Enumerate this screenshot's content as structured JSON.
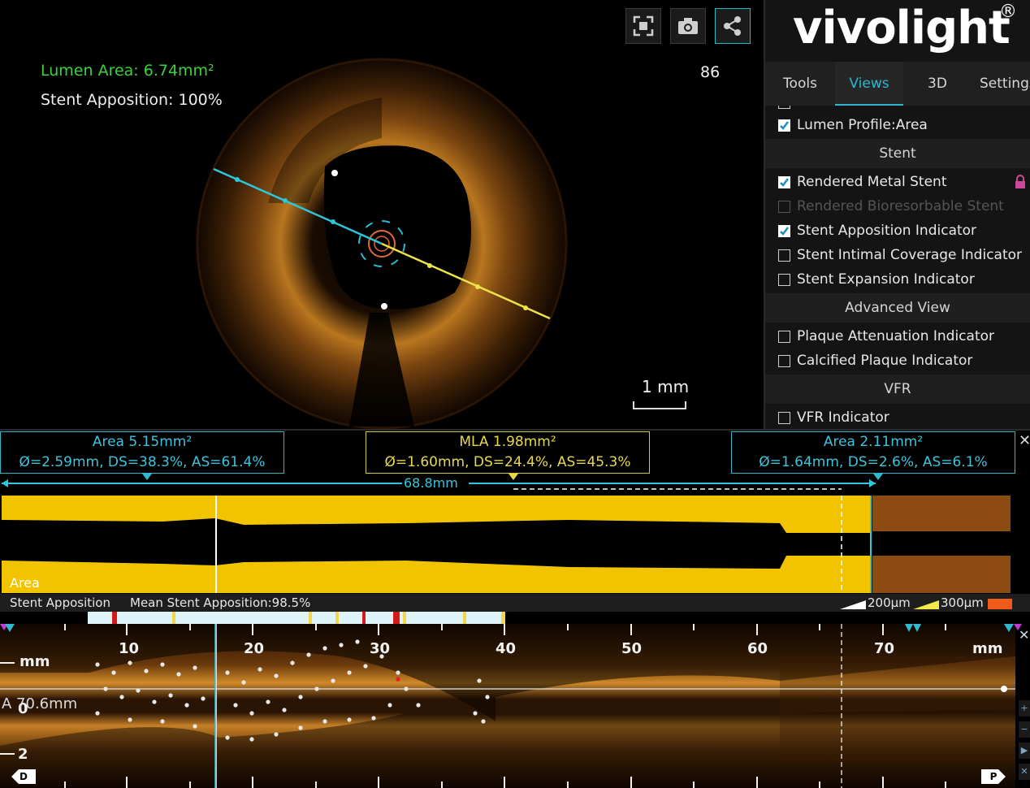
{
  "viewer": {
    "lumen_area": "Lumen Area: 6.74mm²",
    "stent_apposition": "Stent Apposition: 100%",
    "frame_number": "86",
    "scale_label": "1 mm",
    "toolbar": {
      "fullscreen_icon": "fullscreen-icon",
      "camera_icon": "camera-icon",
      "share_icon": "share-icon"
    }
  },
  "panel": {
    "brand": "vivolight",
    "brand_mark": "®",
    "tabs": [
      "Tools",
      "Views",
      "3D",
      "Settings"
    ],
    "active_tab": "Views",
    "items": {
      "lumen_profile": "Lumen Profile:Area",
      "section_stent": "Stent",
      "rendered_metal": "Rendered Metal Stent",
      "rendered_bioresorbable": "Rendered Bioresorbable Stent",
      "stent_apposition": "Stent Apposition Indicator",
      "stent_intimal": "Stent Intimal Coverage Indicator",
      "stent_expansion": "Stent Expansion Indicator",
      "section_advanced": "Advanced View",
      "plaque_attenuation": "Plaque Attenuation Indicator",
      "calcified_plaque": "Calcified Plaque Indicator",
      "section_vfr": "VFR",
      "vfr_indicator": "VFR Indicator"
    },
    "checked": {
      "lumen_profile": true,
      "rendered_metal": true,
      "rendered_bioresorbable": false,
      "stent_apposition": true,
      "stent_intimal": false,
      "stent_expansion": false,
      "plaque_attenuation": false,
      "calcified_plaque": false,
      "vfr_indicator": false
    }
  },
  "measurements": {
    "left": {
      "title": "Area 5.15mm²",
      "detail": "Ø=2.59mm, DS=38.3%, AS=61.4%"
    },
    "middle": {
      "title": "MLA 1.98mm²",
      "detail": "Ø=1.60mm, DS=24.4%, AS=45.3%"
    },
    "right": {
      "title": "Area 2.11mm²",
      "detail": "Ø=1.64mm, DS=2.6%, AS=6.1%"
    },
    "length": "68.8mm"
  },
  "profile": {
    "label": "Area"
  },
  "apposition_strip": {
    "title": "Stent Apposition",
    "mean": "Mean Stent Apposition:98.5%",
    "legend_200": "200µm",
    "legend_300": "300µm"
  },
  "long_view": {
    "ticks": [
      "10",
      "20",
      "30",
      "40",
      "50",
      "60",
      "70"
    ],
    "unit_left": "mm",
    "unit_right": "mm",
    "depth_0": "0",
    "depth_2": "2",
    "cursor_label": "A 70.6mm",
    "distal": "D",
    "proximal": "P"
  },
  "colors": {
    "cyan": "#2fb8cf",
    "yellow": "#f2c400",
    "lumen_green": "#39d23c",
    "brown": "#8b4b12"
  }
}
